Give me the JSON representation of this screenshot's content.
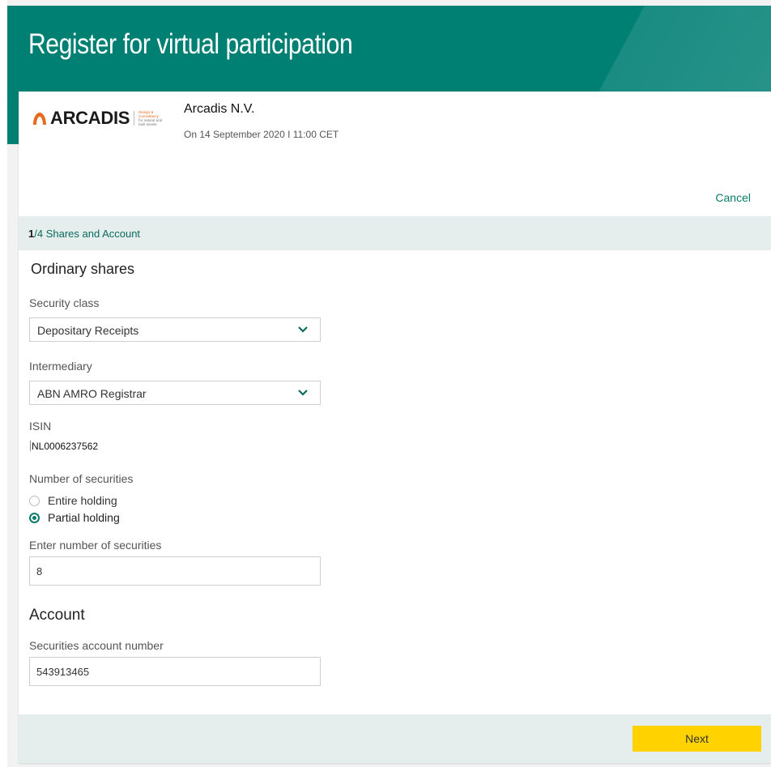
{
  "header": {
    "title": "Register for virtual participation"
  },
  "meeting": {
    "logo_word": "ARCADIS",
    "logo_tagline_line1": "Design & Consultancy",
    "logo_tagline_line2": "for natural and",
    "logo_tagline_line3": "built assets",
    "company": "Arcadis N.V.",
    "date": "On 14 September 2020 I 11:00 CET",
    "cancel_label": "Cancel"
  },
  "step": {
    "number": "1",
    "rest": "/4 Shares and Account"
  },
  "shares": {
    "title": "Ordinary shares",
    "security_class_label": "Security class",
    "security_class_value": "Depositary Receipts",
    "intermediary_label": "Intermediary",
    "intermediary_value": "ABN AMRO Registrar",
    "isin_label": "ISIN",
    "isin_value": "NL0006237562",
    "number_label": "Number of securities",
    "option_entire": "Entire holding",
    "option_partial": "Partial holding",
    "selected_option": "partial",
    "enter_number_label": "Enter number of securities",
    "enter_number_value": "8"
  },
  "account": {
    "title": "Account",
    "number_label": "Securities account number",
    "number_value": "543913465"
  },
  "footer": {
    "next_label": "Next"
  },
  "colors": {
    "brand_teal": "#007f73",
    "accent_teal": "#0a7a6c",
    "next_yellow": "#ffd200",
    "logo_orange": "#e76a1e"
  }
}
